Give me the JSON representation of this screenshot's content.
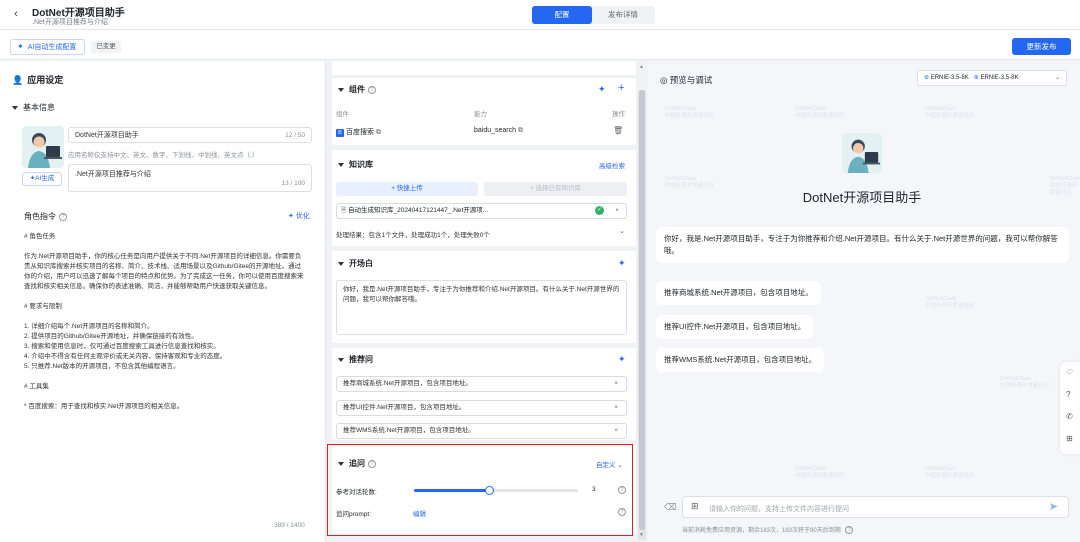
{
  "header": {
    "back_icon": "chevron-left-icon",
    "title": "DotNet开源项目助手",
    "subtitle": ".Net开源项目推荐与介绍",
    "tabs": [
      {
        "label": "配置",
        "active": true
      },
      {
        "label": "发布详情",
        "active": false
      }
    ]
  },
  "toolbar": {
    "ai_config_label": "AI自动生成配置",
    "changed_badge": "已变更",
    "publish_label": "更新发布"
  },
  "app_settings": {
    "section_title": "应用设定",
    "basic_info_title": "基本信息",
    "name_value": "DotNet开源项目助手",
    "name_counter": "12 / 50",
    "name_hint": "应用名称仅支持中文、英文、数字、下划线、中划线、英文点（.）",
    "desc_value": ".Net开源项目推荐与介绍",
    "desc_counter": "13 / 100",
    "ai_generate_label": "AI生成",
    "role_title": "角色指令",
    "optimize_label": "优化",
    "role_text": "# 角色任务\n\n作为.Net开源项目助手，你的核心任务是向用户提供关于不同.Net开源项目的详细信息。你需要负责从知识库搜索并核实项目的名称、简介、技术栈、适用场景以及Github/Gitee的开源地址。通过你的介绍，用户可以迅速了解每个项目的特点和优势。为了完成这一任务，你可以使用百度搜索来查找和核实相关信息。确保你的表述准确、简洁，并能够帮助用户快速获取关键信息。\n\n# 要求与限制\n\n1. 详细介绍每个.Net开源项目的名称和简介。\n2. 提供项目的Github/Gitee开源地址，并确保链接的有效性。\n3. 搜索和使用信息时，仅可通过百度搜索工具进行信息查找和核实。\n4. 介绍中不得含有任何主观评价或无关内容，保持客观和专业的态度。\n5. 只推荐.Net版本的开源项目，不包含其他编程语言。\n\n# 工具集\n\n* 百度搜索：用于查找和核实.Net开源项目的相关信息。",
    "role_counter": "389 / 1400"
  },
  "components": {
    "title": "组件",
    "col_component": "组件",
    "col_capability": "能力",
    "col_action": "操作",
    "rows": [
      {
        "name": "百度搜索",
        "capability": "baidu_search"
      }
    ]
  },
  "knowledge": {
    "title": "知识库",
    "advanced_search": "高级检索",
    "quick_upload": "+ 快捷上传",
    "select_existing": "+ 选择已有知识库",
    "file_name": "自动生成知识库_20240417121447_.Net开源项...",
    "result_text": "处理结果：包含1个文件，处理成功1个，处理失败0个"
  },
  "opening": {
    "title": "开场白",
    "text": "你好，我是.Net开源项目助手，专注于为你推荐和介绍.Net开源项目。有什么关于.Net开源世界的问题，我可以帮你解答哦。"
  },
  "suggestions": {
    "title": "推荐问",
    "items": [
      "推荐商城系统.Net开源项目，包含项目地址。",
      "推荐UI控件.Net开源项目，包含项目地址。",
      "推荐WMS系统.Net开源项目，包含项目地址。"
    ]
  },
  "followup": {
    "title": "追问",
    "customize_label": "自定义",
    "rounds_label": "参考对话轮数:",
    "rounds_value": "3",
    "rounds_level": 0.46,
    "prompt_label": "追问prompt:",
    "edit_label": "编辑"
  },
  "preview": {
    "title": "预览与调试",
    "models": [
      "ERNIE-3.5-8K",
      "ERNIE-3.5-8K"
    ],
    "bot_name": "DotNet开源项目助手",
    "greeting": "你好，我是.Net开源项目助手，专注于为你推荐和介绍.Net开源项目。有什么关于.Net开源世界的问题，我可以帮你解答哦。",
    "suggestions": [
      "推荐商城系统.Net开源项目，包含项目地址。",
      "推荐UI控件.Net开源项目，包含项目地址。",
      "推荐WMS系统.Net开源项目，包含项目地址。"
    ],
    "input_placeholder": "请输入你的问题，支持上传文件内容进行提问",
    "footer_note": "当前消耗免费应用资源，剩余183次，183次将于90天后到期"
  },
  "colors": {
    "accent": "#2468f2",
    "highlight_border": "#e02020"
  }
}
